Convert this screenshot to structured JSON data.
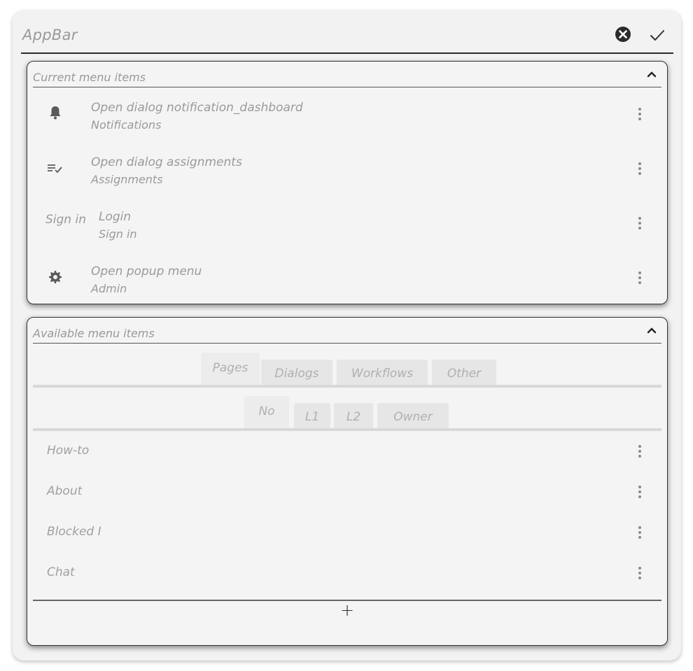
{
  "appbar": {
    "title": "AppBar",
    "close_icon": "close-circle-icon",
    "confirm_icon": "check-icon"
  },
  "current": {
    "title": "Current menu items",
    "chevron": "chevron-up-icon",
    "items": [
      {
        "icon": "bell-icon",
        "title": "Open dialog notification_dashboard",
        "subtitle": "Notifications"
      },
      {
        "icon": "playlist-check-icon",
        "title": "Open dialog assignments",
        "subtitle": "Assignments"
      },
      {
        "lead_text": "Sign in",
        "title": "Login",
        "subtitle": "Sign in"
      },
      {
        "icon": "gear-icon",
        "title": "Open popup menu",
        "subtitle": "Admin"
      }
    ]
  },
  "available": {
    "title": "Available menu items",
    "chevron": "chevron-up-icon",
    "tabs": [
      "Pages",
      "Dialogs",
      "Workflows",
      "Other"
    ],
    "active_tab": "Pages",
    "subtabs": [
      "No",
      "L1",
      "L2",
      "Owner"
    ],
    "active_subtab": "No",
    "items": [
      "How-to",
      "About",
      "Blocked I",
      "Chat"
    ],
    "add_label": "+"
  }
}
